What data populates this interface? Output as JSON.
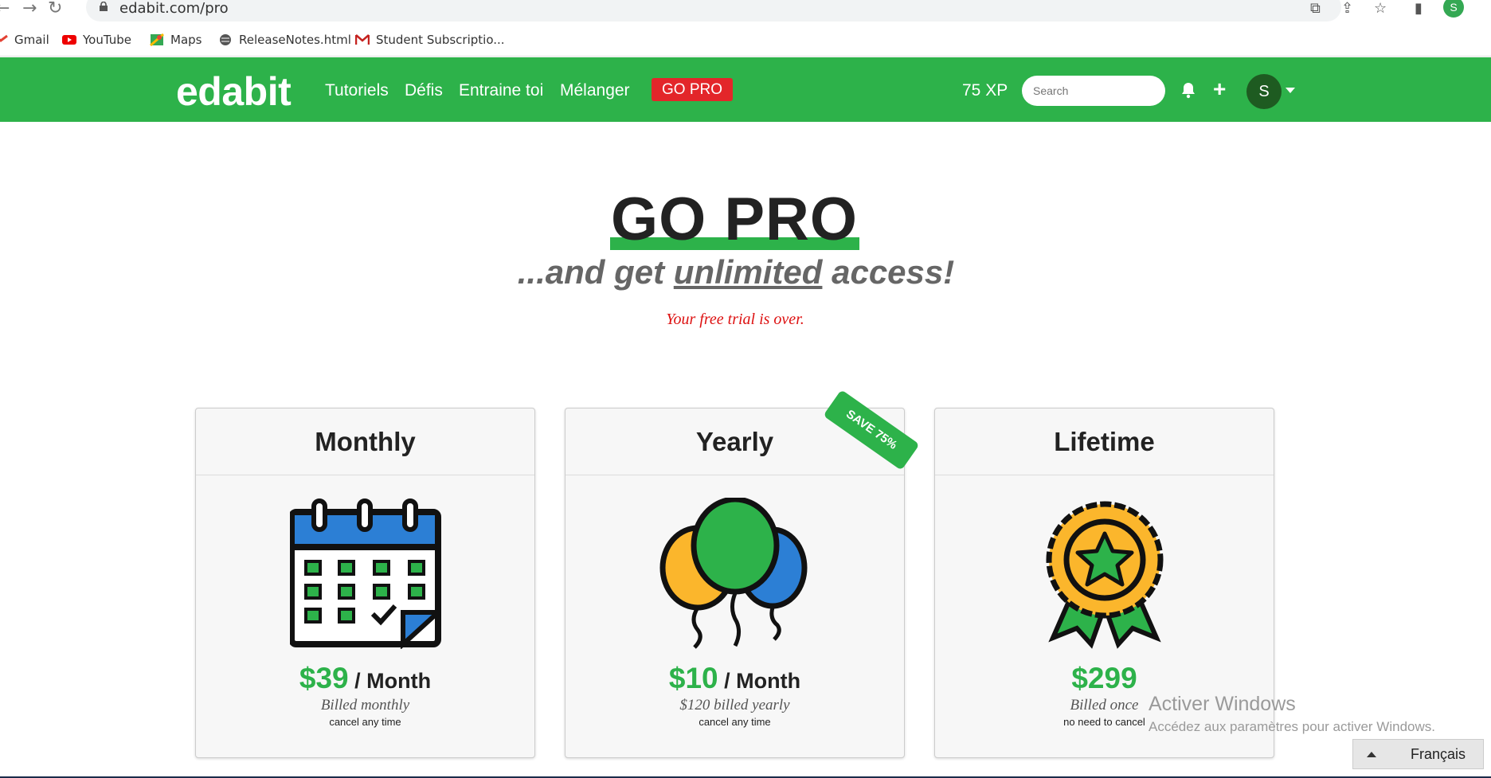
{
  "browser": {
    "url": "edabit.com/pro",
    "bookmarks": [
      "Gmail",
      "YouTube",
      "Maps",
      "ReleaseNotes.html",
      "Student Subscriptio..."
    ],
    "profile_initial": "S"
  },
  "site": {
    "logo": "edabit",
    "nav": [
      "Tutoriels",
      "Défis",
      "Entraine toi",
      "Mélanger"
    ],
    "gopro_label": "GO PRO",
    "xp": "75 XP",
    "search_placeholder": "Search",
    "avatar_initial": "S",
    "brand_green": "#2db24a",
    "accent_red": "#e3262a"
  },
  "hero": {
    "title": "GO PRO",
    "subtitle_pre": "...and get ",
    "subtitle_em": "unlimited",
    "subtitle_post": " access!",
    "trial_notice": "Your free trial is over."
  },
  "plans": [
    {
      "name": "Monthly",
      "icon": "calendar-icon",
      "amount": "$39",
      "unit": " / Month",
      "billed": "Billed monthly",
      "note": "cancel any time"
    },
    {
      "name": "Yearly",
      "icon": "balloons-icon",
      "amount": "$10",
      "unit": " / Month",
      "billed": "$120 billed yearly",
      "note": "cancel any time",
      "ribbon": "SAVE 75%"
    },
    {
      "name": "Lifetime",
      "icon": "award-badge-icon",
      "amount": "$299",
      "unit": "",
      "billed": "Billed once",
      "note": "no need to cancel"
    }
  ],
  "overlay": {
    "watermark_title": "Activer Windows",
    "watermark_sub": "Accédez aux paramètres pour activer Windows.",
    "language": "Français"
  }
}
